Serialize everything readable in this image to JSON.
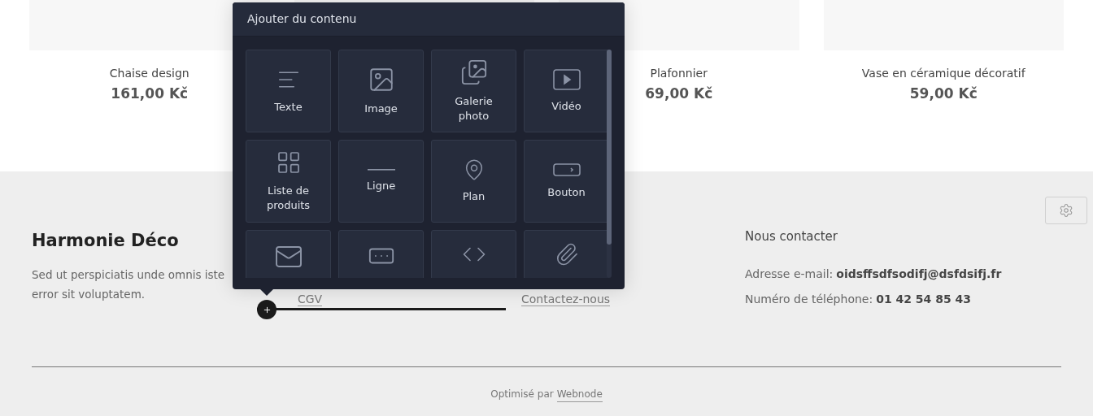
{
  "products": [
    {
      "name": "Chaise design",
      "price": "161,00 Kč"
    },
    {
      "name": "Plafonnier",
      "price": "69,00 Kč"
    },
    {
      "name": "Vase en céramique décoratif",
      "price": "59,00 Kč"
    }
  ],
  "footer": {
    "brand": "Harmonie Déco",
    "description": "Sed ut perspiciatis unde omnis iste error sit voluptatem.",
    "links": [
      {
        "label": "CGV"
      },
      {
        "label": "Contactez-nous"
      }
    ],
    "contact": {
      "heading": "Nous contacter",
      "email_label": "Adresse e-mail:",
      "email": "oidsffsdfsodifj@dsfdsifj.fr",
      "phone_label": "Numéro de téléphone:",
      "phone": "01 42 54 85 43"
    },
    "credit": "Optimisé par",
    "credit_link": "Webnode"
  },
  "popup": {
    "title": "Ajouter du contenu",
    "tiles": [
      {
        "kind": "text",
        "label": "Texte"
      },
      {
        "kind": "image",
        "label": "Image"
      },
      {
        "kind": "gallery",
        "label": "Galerie photo"
      },
      {
        "kind": "video",
        "label": "Vidéo"
      },
      {
        "kind": "products",
        "label": "Liste de produits"
      },
      {
        "kind": "line",
        "label": "Ligne"
      },
      {
        "kind": "map",
        "label": "Plan"
      },
      {
        "kind": "button",
        "label": "Bouton"
      },
      {
        "kind": "mail"
      },
      {
        "kind": "field"
      },
      {
        "kind": "code"
      },
      {
        "kind": "file"
      }
    ]
  }
}
